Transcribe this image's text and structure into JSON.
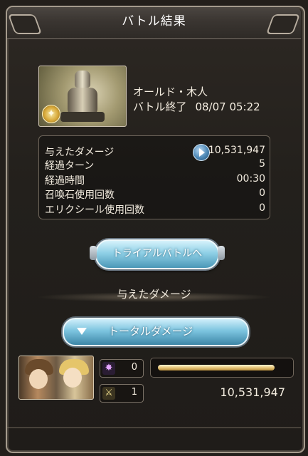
{
  "window": {
    "title": "バトル結果"
  },
  "enemy": {
    "name": "オールド・木人",
    "icon": "wind-element-icon"
  },
  "battle": {
    "end_label": "バトル終了",
    "end_time": "08/07 05:22"
  },
  "stats": {
    "damage_label": "与えたダメージ",
    "damage_value": "10,531,947",
    "turns_label": "経過ターン",
    "turns_value": "5",
    "time_label": "経過時間",
    "time_value": "00:30",
    "summons_label": "召喚石使用回数",
    "summons_value": "0",
    "elixir_label": "エリクシール使用回数",
    "elixir_value": "0"
  },
  "buttons": {
    "trial": "トライアルバトルへ",
    "total_damage": "トータルダメージ"
  },
  "section": {
    "title": "与えたダメージ"
  },
  "party": {
    "chip1_icon": "purple-star-icon",
    "chip1_value": "0",
    "chip2_icon": "crossed-swords-icon",
    "chip2_value": "1",
    "hp_fraction": 0.91,
    "damage": "10,531,947"
  },
  "colors": {
    "accent": "#7cc4df",
    "gold_bar": "#e7c77a"
  }
}
